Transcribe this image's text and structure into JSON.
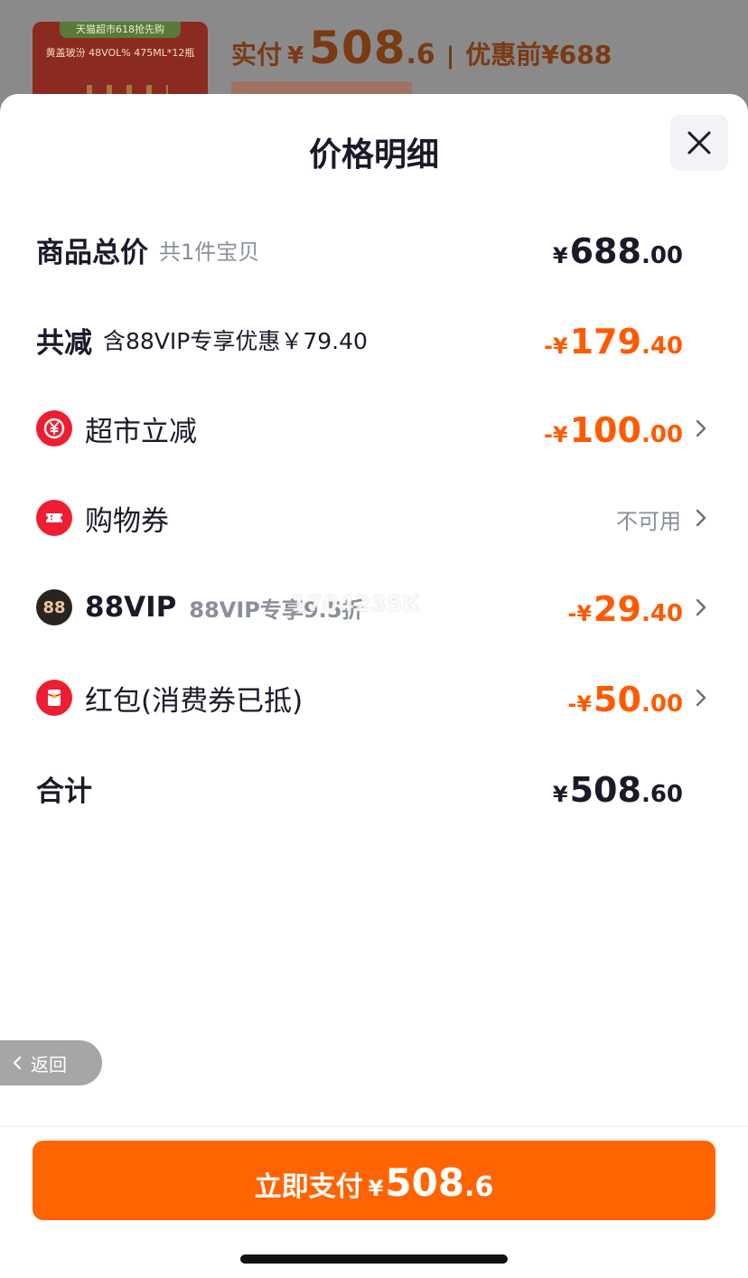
{
  "background": {
    "thumb_banner": "天猫超市618抢先购",
    "thumb_text": "黄盖玻汾 48VOL% 475ML*12瓶",
    "paid_label": "实付",
    "currency": "¥",
    "paid_int": "508",
    "paid_dec": ".6",
    "separator": "|",
    "orig_label": "优惠前",
    "orig_price": "¥688"
  },
  "sheet": {
    "title": "价格明细",
    "close_icon": "close-icon"
  },
  "rows": {
    "total": {
      "label": "商品总价",
      "sub": "共1件宝贝",
      "yen": "¥",
      "int": "688",
      "dec": ".00"
    },
    "reduce": {
      "label": "共减",
      "sub": "含88VIP专享优惠￥79.40",
      "yen": "-¥",
      "int": "179",
      "dec": ".40"
    },
    "supermarket": {
      "icon": "yuan-coin-icon",
      "label": "超市立减",
      "yen": "-¥",
      "int": "100",
      "dec": ".00"
    },
    "coupon": {
      "icon": "ticket-icon",
      "label": "购物券",
      "status": "不可用"
    },
    "vip": {
      "icon": "88-badge-icon",
      "badge_text": "88",
      "label": "88VIP",
      "sub": "88VIP专享9.5折",
      "watermark": "1704235K",
      "yen": "-¥",
      "int": "29",
      "dec": ".40"
    },
    "redpacket": {
      "icon": "red-packet-icon",
      "label": "红包(消费券已抵)",
      "yen": "-¥",
      "int": "50",
      "dec": ".00"
    },
    "sum": {
      "label": "合计",
      "yen": "¥",
      "int": "508",
      "dec": ".60"
    }
  },
  "back": {
    "label": "返回"
  },
  "pay_button": {
    "label": "立即支付",
    "yen": "¥",
    "int": "508",
    "dec": ".6"
  },
  "colors": {
    "accent": "#ff6400",
    "discount": "#ff5a00",
    "icon_red": "#ef1d32"
  }
}
